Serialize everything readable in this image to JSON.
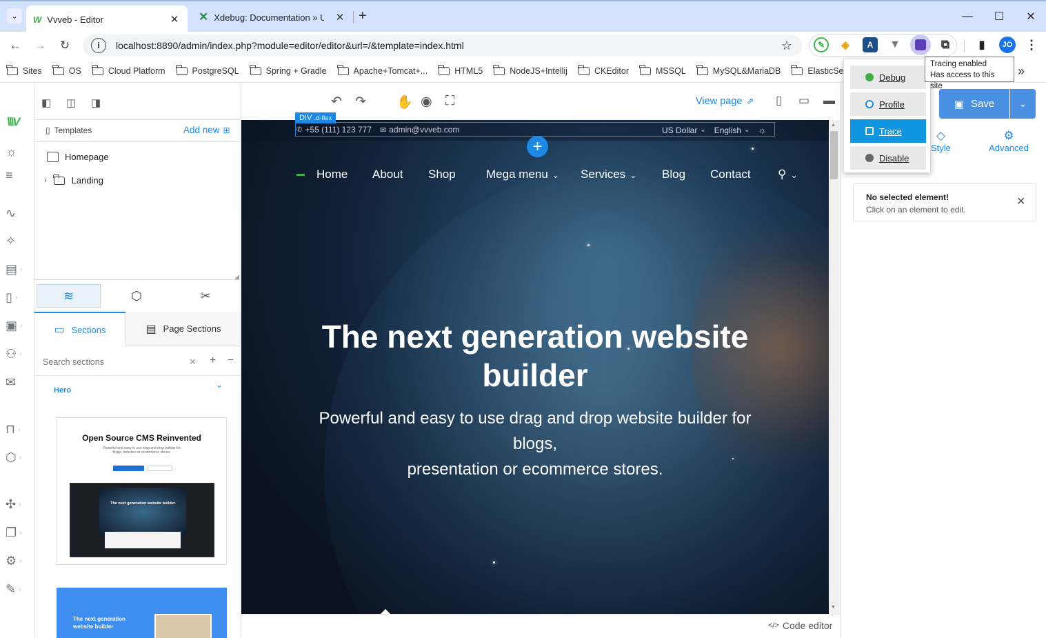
{
  "browser": {
    "tabs": [
      {
        "title": "Vvveb - Editor"
      },
      {
        "title": "Xdebug: Documentation » Upg"
      }
    ],
    "new_tab": "+",
    "url": "localhost:8890/admin/index.php?module=editor/editor&url=/&template=index.html",
    "profile_initials": "JO",
    "bookmarks": [
      "Sites",
      "OS",
      "Cloud Platform",
      "PostgreSQL",
      "Spring + Gradle",
      "Apache+Tomcat+...",
      "HTML5",
      "NodeJS+Intellij",
      "CKEditor",
      "MSSQL",
      "MySQL&MariaDB",
      "ElasticSear"
    ],
    "more_bookmarks": "»"
  },
  "xdebug_popup": {
    "buttons": [
      {
        "label": "Debug",
        "color": "#3fae49"
      },
      {
        "label": "Profile",
        "color": "#1e88e5"
      },
      {
        "label": "Trace",
        "color": "#1e88e5"
      },
      {
        "label": "Disable",
        "color": "#666666"
      }
    ],
    "active": "Trace",
    "active_color": "#1095e0",
    "tooltip_line1": "Tracing enabled",
    "tooltip_line2": "Has access to this site"
  },
  "left_panel": {
    "templates_label": "Templates",
    "add_new": "Add new",
    "files": [
      {
        "name": "Homepage"
      },
      {
        "name": "Landing"
      }
    ],
    "tabs": [
      {
        "label": "Sections"
      },
      {
        "label": "Page Sections"
      }
    ],
    "search_placeholder": "Search sections",
    "group": "Hero",
    "preview1_title": "Open Source CMS Reinvented",
    "preview1_sub": "Powerful and easy to use drag and drop builder for blogs, websites or ecommerce stores.",
    "preview1_inner": "The next generation website builder",
    "preview2_title": "The next generation website builder"
  },
  "top_bar": {
    "view_page": "View page"
  },
  "canvas": {
    "selected_tag": "DIV",
    "selected_class": ".d-flex",
    "phone": "+55 (111) 123 777",
    "email": "admin@vvveb.com",
    "currency": "US Dollar",
    "language": "English",
    "add_button": "+",
    "nav": [
      "Home",
      "About",
      "Shop",
      "Mega menu",
      "Services",
      "Blog",
      "Contact"
    ],
    "hero_title_1": "The next generation website",
    "hero_title_2": "builder",
    "hero_sub_1": "Powerful and easy to use drag and drop website builder for",
    "hero_sub_2": "blogs,",
    "hero_sub_3": "presentation or ecommerce stores."
  },
  "right_panel": {
    "save": "Save",
    "tab_style": "Style",
    "tab_advanced": "Advanced",
    "notice_title": "No selected element!",
    "notice_text": "Click on an element to edit."
  },
  "bottom_bar": {
    "code_editor": "Code editor"
  },
  "colors": {
    "accent": "#1e88e5",
    "save_bg": "#4a90e2",
    "vvveb_green": "#3bb54a"
  }
}
